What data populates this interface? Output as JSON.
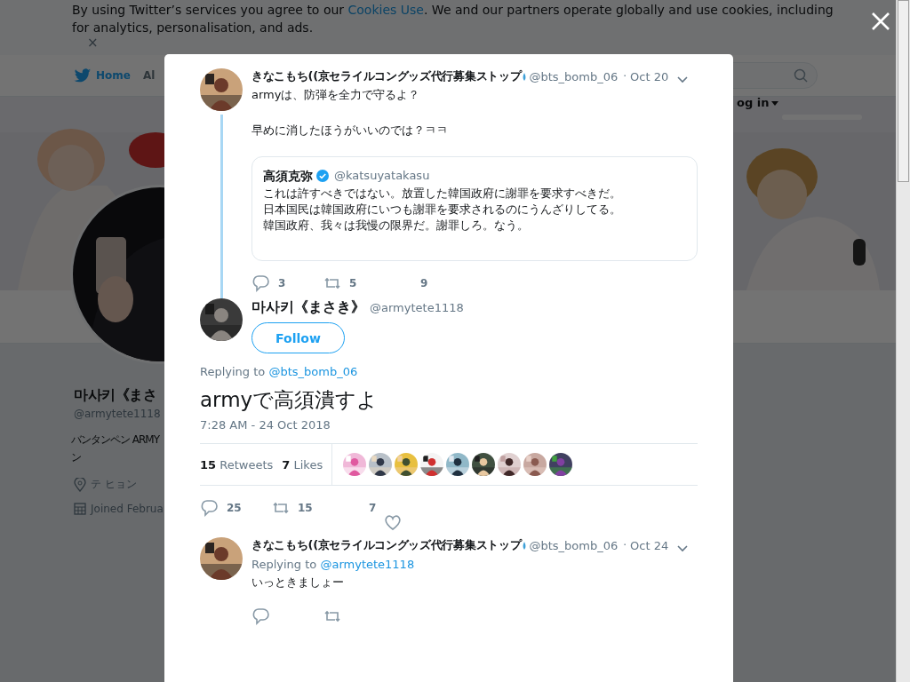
{
  "cookie_banner": {
    "text_before": "By using Twitter’s services you agree to our",
    "link": "Cookies Use",
    "text_after": ". We and our partners operate globally and use cookies, including for analytics, personalisation, and ads.",
    "dismiss": "×"
  },
  "nav": {
    "items": [
      {
        "label": "Home",
        "selected": true
      },
      {
        "label": "Al",
        "selected": false
      }
    ],
    "login": "og in"
  },
  "profile": {
    "name": "마사키《まさ",
    "handle": "@armytete1118",
    "bio": [
      "バンタンペン ARMY",
      "ン"
    ],
    "location": "テ ヒョン",
    "joined": "Joined Februa"
  },
  "modal": {
    "parent_tweet": {
      "name": "きなこもち((京セライルコングッズ代行募集ストップ",
      "handle": "@bts_bomb_06",
      "separator": "·",
      "time": "Oct 20",
      "lines": [
        "armyは、防弾を全力で守るよ？",
        "早めに消したほうがいいのでは？ㅋㅋ"
      ],
      "quote": {
        "name": "高須克弥",
        "verified": true,
        "handle": "@katsuyatakasu",
        "lines": [
          "これは許すべきではない。放置した韓国政府に謝罪を要求すべきだ。",
          "日本国民は韓国政府にいつも謝罪を要求されるのにうんざりしてる。",
          "韓国政府、我々は我慢の限界だ。謝罪しろ。なう。"
        ]
      },
      "replies": "3",
      "retweets": "5",
      "likes": "9"
    },
    "main_tweet": {
      "name": "마사키《まさき》",
      "handle": "@armytete1118",
      "follow": "Follow",
      "replying_label": "Replying to",
      "replying_to": "@bts_bomb_06",
      "text": "armyで高須潰すよ",
      "timestamp": "7:28 AM - 24 Oct 2018",
      "retweet_count": "15",
      "retweet_label": "Retweets",
      "like_count": "7",
      "like_label": "Likes",
      "replies": "25",
      "retweets": "15",
      "likes": "7"
    },
    "reply_tweet": {
      "name": "きなこもち((京セライルコングッズ代行募集ストップ",
      "handle": "@bts_bomb_06",
      "separator": "·",
      "time": "Oct 24",
      "replying_label": "Replying to",
      "replying_to": "@armytete1118",
      "text": "いっときましょー"
    }
  }
}
